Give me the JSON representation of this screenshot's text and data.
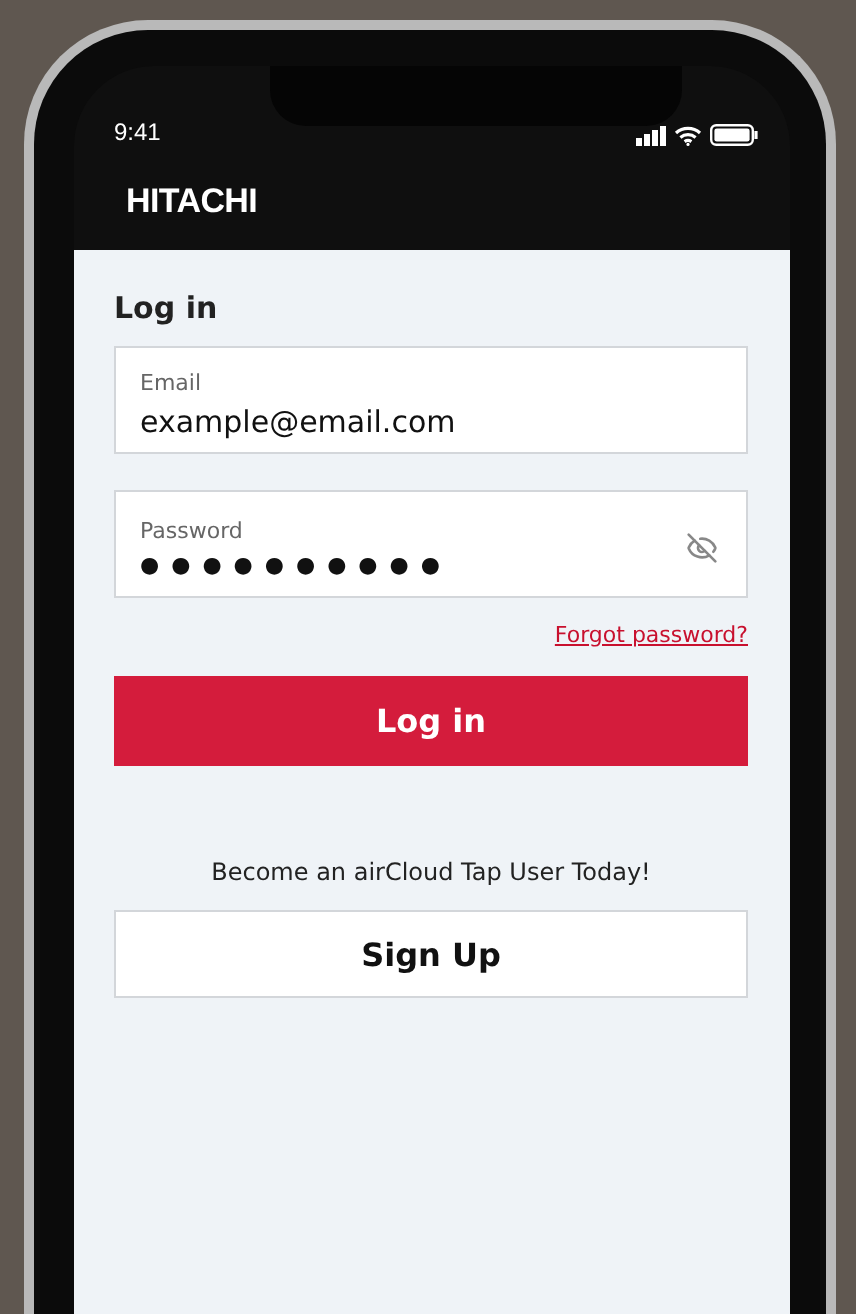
{
  "status_bar": {
    "time": "9:41"
  },
  "header": {
    "logo": "HITACHI"
  },
  "title": "Log in",
  "fields": [
    {
      "kind": "text",
      "label": "Email",
      "value": "example@email.com"
    },
    {
      "kind": "password",
      "label": "Password",
      "value": "●●●●●●●●●●"
    }
  ],
  "forgot_link": "Forgot password?",
  "login_button": "Log in",
  "promo": "Become an airCloud Tap User Today!",
  "signup_button": "Sign Up"
}
